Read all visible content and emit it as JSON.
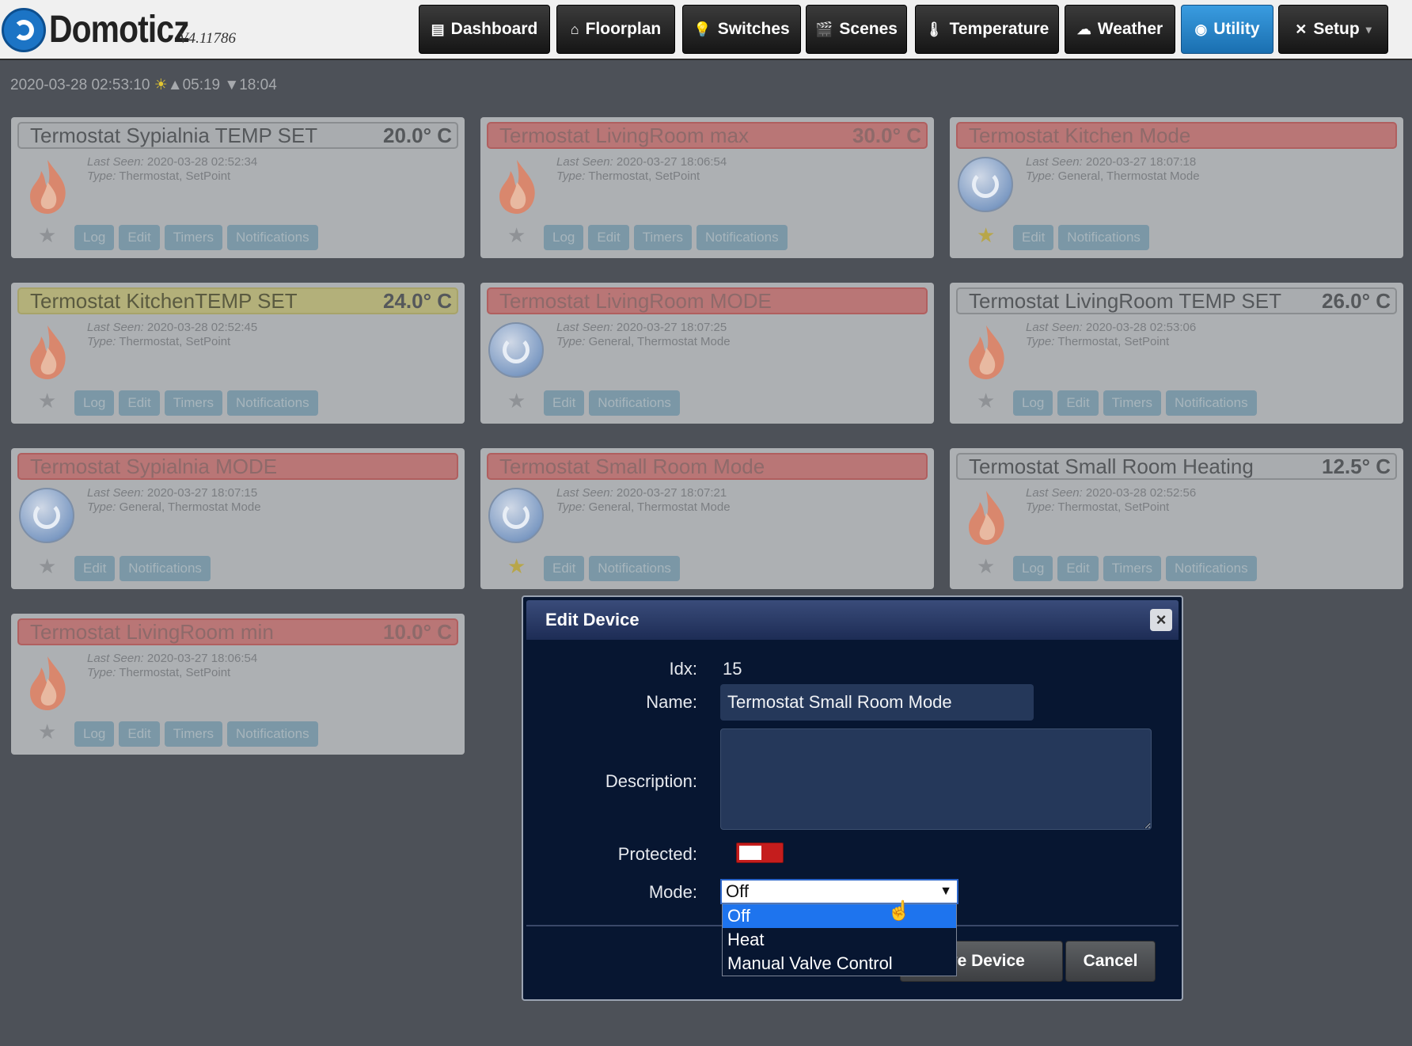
{
  "app": {
    "name": "Domoticz",
    "version": "V4.11786"
  },
  "nav": [
    {
      "label": "Dashboard",
      "icon": "dashboard-icon",
      "glyph": "▤"
    },
    {
      "label": "Floorplan",
      "icon": "floorplan-icon",
      "glyph": "⌂"
    },
    {
      "label": "Switches",
      "icon": "lightbulb-icon",
      "glyph": "💡"
    },
    {
      "label": "Scenes",
      "icon": "scenes-icon",
      "glyph": "🎬"
    },
    {
      "label": "Temperature",
      "icon": "thermometer-icon",
      "glyph": "🌡"
    },
    {
      "label": "Weather",
      "icon": "weather-icon",
      "glyph": "☁"
    },
    {
      "label": "Utility",
      "icon": "utility-icon",
      "glyph": "◉"
    },
    {
      "label": "Setup",
      "icon": "setup-icon",
      "glyph": "✕"
    }
  ],
  "status_bar": {
    "datetime": "2020-03-28 02:53:10",
    "sunrise": "05:19",
    "sunset": "18:04"
  },
  "devices": [
    {
      "title": "Termostat Sypialnia TEMP SET",
      "value": "20.0° C",
      "status": "normal",
      "last_seen": "2020-03-28 02:52:34",
      "type": "Thermostat, SetPoint",
      "icon": "flame-icon",
      "favorite": false,
      "buttons": [
        "Log",
        "Edit",
        "Timers",
        "Notifications"
      ]
    },
    {
      "title": "Termostat LivingRoom max",
      "value": "30.0° C",
      "status": "red",
      "last_seen": "2020-03-27 18:06:54",
      "type": "Thermostat, SetPoint",
      "icon": "flame-icon",
      "favorite": false,
      "buttons": [
        "Log",
        "Edit",
        "Timers",
        "Notifications"
      ]
    },
    {
      "title": "Termostat Kitchen Mode",
      "value": "",
      "status": "red",
      "last_seen": "2020-03-27 18:07:18",
      "type": "General, Thermostat Mode",
      "icon": "mode-icon",
      "favorite": true,
      "buttons": [
        "Edit",
        "Notifications"
      ]
    },
    {
      "title": "Termostat KitchenTEMP SET",
      "value": "24.0° C",
      "status": "yellow",
      "last_seen": "2020-03-28 02:52:45",
      "type": "Thermostat, SetPoint",
      "icon": "flame-icon",
      "favorite": false,
      "buttons": [
        "Log",
        "Edit",
        "Timers",
        "Notifications"
      ]
    },
    {
      "title": "Termostat LivingRoom MODE",
      "value": "",
      "status": "red",
      "last_seen": "2020-03-27 18:07:25",
      "type": "General, Thermostat Mode",
      "icon": "mode-icon",
      "favorite": false,
      "buttons": [
        "Edit",
        "Notifications"
      ]
    },
    {
      "title": "Termostat LivingRoom TEMP SET",
      "value": "26.0° C",
      "status": "normal",
      "last_seen": "2020-03-28 02:53:06",
      "type": "Thermostat, SetPoint",
      "icon": "flame-icon",
      "favorite": false,
      "buttons": [
        "Log",
        "Edit",
        "Timers",
        "Notifications"
      ]
    },
    {
      "title": "Termostat Sypialnia MODE",
      "value": "",
      "status": "red",
      "last_seen": "2020-03-27 18:07:15",
      "type": "General, Thermostat Mode",
      "icon": "mode-icon",
      "favorite": false,
      "buttons": [
        "Edit",
        "Notifications"
      ]
    },
    {
      "title": "Termostat Small Room Mode",
      "value": "",
      "status": "red",
      "last_seen": "2020-03-27 18:07:21",
      "type": "General, Thermostat Mode",
      "icon": "mode-icon",
      "favorite": true,
      "buttons": [
        "Edit",
        "Notifications"
      ]
    },
    {
      "title": "Termostat Small Room Heating",
      "value": "12.5° C",
      "status": "normal",
      "last_seen": "2020-03-28 02:52:56",
      "type": "Thermostat, SetPoint",
      "icon": "flame-icon",
      "favorite": false,
      "buttons": [
        "Log",
        "Edit",
        "Timers",
        "Notifications"
      ]
    },
    {
      "title": "Termostat LivingRoom min",
      "value": "10.0° C",
      "status": "red",
      "last_seen": "2020-03-27 18:06:54",
      "type": "Thermostat, SetPoint",
      "icon": "flame-icon",
      "favorite": false,
      "buttons": [
        "Log",
        "Edit",
        "Timers",
        "Notifications"
      ]
    }
  ],
  "labels": {
    "last_seen": "Last Seen:",
    "type": "Type:"
  },
  "modal": {
    "title": "Edit Device",
    "close": "×",
    "idx_label": "Idx:",
    "idx": "15",
    "name_label": "Name:",
    "name": "Termostat Small Room Mode",
    "description_label": "Description:",
    "description": "",
    "protected_label": "Protected:",
    "protected": false,
    "mode_label": "Mode:",
    "mode": "Off",
    "mode_options": [
      "Off",
      "Heat",
      "Manual Valve Control"
    ],
    "save_button": "ove Device",
    "cancel_button": "Cancel"
  },
  "colors": {
    "accent": "#1e74ee",
    "toggle_off": "#c51d1d",
    "modal_bg": "#071631"
  }
}
